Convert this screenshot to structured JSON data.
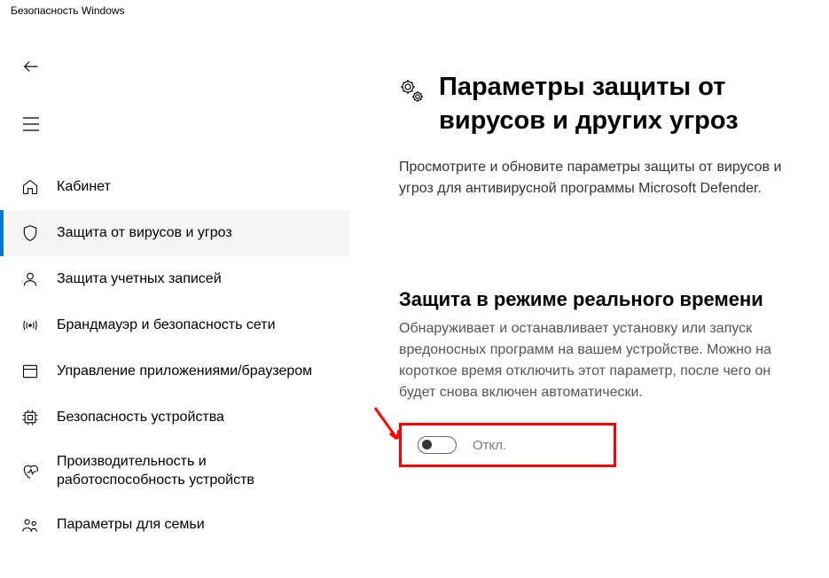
{
  "window": {
    "title": "Безопасность Windows"
  },
  "sidebar": {
    "items": [
      {
        "id": "home",
        "label": "Кабинет",
        "active": false
      },
      {
        "id": "virus",
        "label": "Защита от вирусов и угроз",
        "active": true
      },
      {
        "id": "account",
        "label": "Защита учетных записей",
        "active": false
      },
      {
        "id": "firewall",
        "label": "Брандмауэр и безопасность сети",
        "active": false
      },
      {
        "id": "app",
        "label": "Управление приложениями/браузером",
        "active": false
      },
      {
        "id": "device",
        "label": "Безопасность устройства",
        "active": false
      },
      {
        "id": "perf",
        "label": "Производительность и работоспособность устройств",
        "active": false
      },
      {
        "id": "family",
        "label": "Параметры для семьи",
        "active": false
      }
    ]
  },
  "main": {
    "title": "Параметры защиты от вирусов и других угроз",
    "subtitle": "Просмотрите и обновите параметры защиты от вирусов и угроз для антивирусной программы Microsoft Defender.",
    "section": {
      "title": "Защита в режиме реального времени",
      "desc": "Обнаруживает и останавливает установку или запуск вредоносных программ на вашем устройстве. Можно на короткое время отключить этот параметр, после чего он будет снова включен автоматически.",
      "toggle_label": "Откл."
    }
  }
}
